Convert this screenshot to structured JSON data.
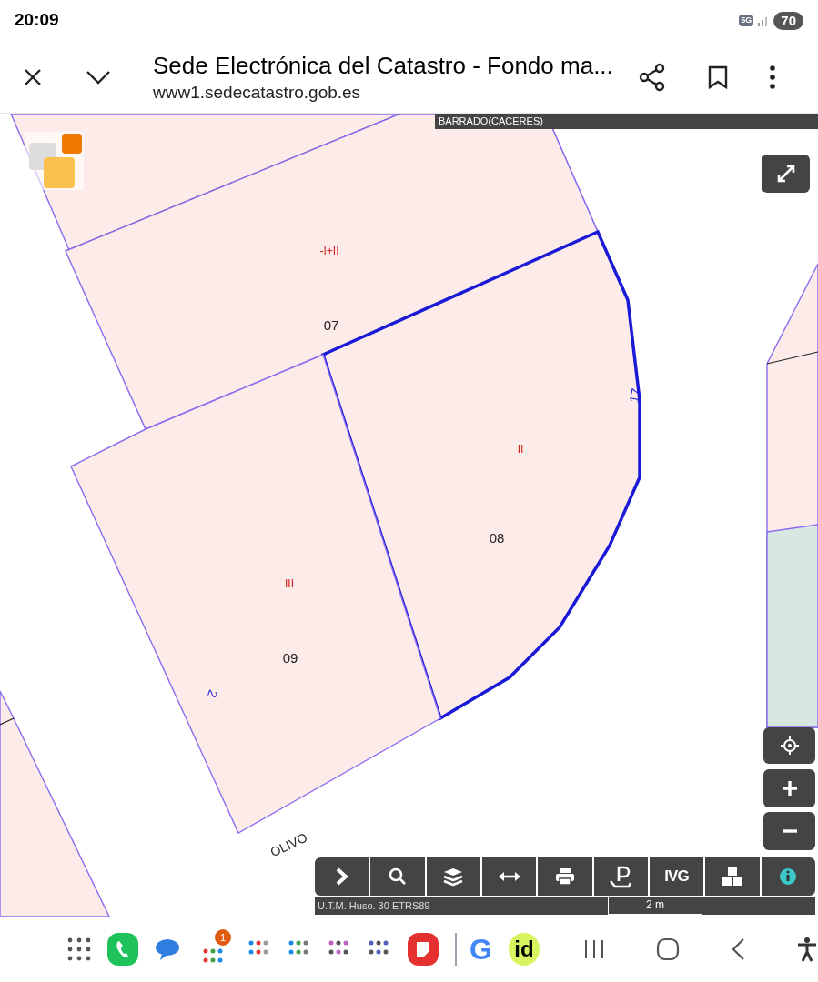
{
  "status_bar": {
    "time": "20:09",
    "network": "5G",
    "battery": "70"
  },
  "header": {
    "title": "Sede Electrónica del Catastro - Fondo ma...",
    "url": "www1.sedecatastro.gob.es"
  },
  "map": {
    "locality": "BARRADO(CACERES)",
    "parcels": [
      {
        "number": "07",
        "class": "-I+II",
        "selected": false
      },
      {
        "number": "08",
        "class": "II",
        "selected": true
      },
      {
        "number": "09",
        "class": "III",
        "selected": false
      }
    ],
    "street_numbers": [
      "17",
      "2"
    ],
    "street_name": "OLIVO",
    "projection": "U.T.M. Huso. 30 ETRS89",
    "scale": "2 m"
  },
  "toolbar": [
    {
      "kind": "chevron"
    },
    {
      "kind": "search"
    },
    {
      "kind": "layers"
    },
    {
      "kind": "measure"
    },
    {
      "kind": "print"
    },
    {
      "kind": "parcel"
    },
    {
      "kind": "text",
      "label": "IVG"
    },
    {
      "kind": "cubes"
    },
    {
      "kind": "info"
    }
  ],
  "nav_bar": {
    "apps": [
      {
        "kind": "grid"
      },
      {
        "kind": "phone"
      },
      {
        "kind": "messages"
      },
      {
        "kind": "folder",
        "badge": "1"
      },
      {
        "kind": "folder"
      },
      {
        "kind": "folder"
      },
      {
        "kind": "folder"
      },
      {
        "kind": "folder"
      },
      {
        "kind": "notes"
      },
      {
        "kind": "google",
        "label": "G"
      },
      {
        "kind": "id",
        "label": "id"
      }
    ]
  }
}
